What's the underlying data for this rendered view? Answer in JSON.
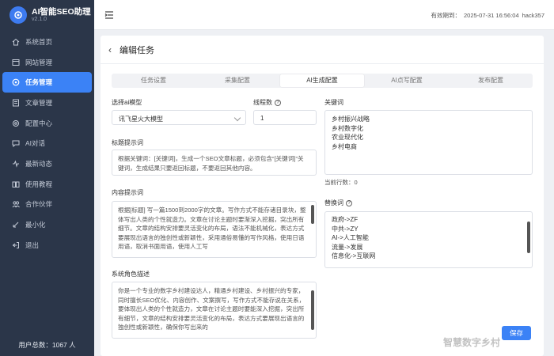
{
  "brand": {
    "title": "AI智能SEO助理",
    "version": "v2.1.0"
  },
  "sidebar": {
    "items": [
      {
        "label": "系统首页",
        "icon": "home-icon"
      },
      {
        "label": "网站管理",
        "icon": "website-icon"
      },
      {
        "label": "任务管理",
        "icon": "task-icon",
        "active": true
      },
      {
        "label": "文章管理",
        "icon": "article-icon"
      },
      {
        "label": "配置中心",
        "icon": "config-icon"
      },
      {
        "label": "AI对话",
        "icon": "chat-icon"
      },
      {
        "label": "最新动态",
        "icon": "news-icon"
      },
      {
        "label": "使用教程",
        "icon": "tutorial-icon"
      },
      {
        "label": "合作伙伴",
        "icon": "partner-icon"
      },
      {
        "label": "最小化",
        "icon": "minimize-icon"
      },
      {
        "label": "退出",
        "icon": "logout-icon"
      }
    ],
    "footer": "用户总数：1067 人"
  },
  "topbar": {
    "expiry_label": "有效期到：",
    "expiry_value": "2025-07-31 16:56:04",
    "username": "hack357"
  },
  "page": {
    "title": "编辑任务"
  },
  "tabs": [
    "任务设置",
    "采集配置",
    "AI生成配置",
    "AI点写配置",
    "发布配置"
  ],
  "form": {
    "model_label": "选择ai模型",
    "model_value": "讯飞星火大模型",
    "threads_label": "线程数",
    "threads_value": "1",
    "keywords_label": "关键词",
    "keywords": [
      "乡村振兴战略",
      "乡村数字化",
      "农业现代化",
      "乡村电商"
    ],
    "keywords_count": "当前行数：0",
    "title_prompt_label": "标题提示词",
    "title_prompt": "根据关键词：[关键词]，生成一个SEO文章标题，必须包含“[关键词]”关键词，生成结果只要返回标题，不要返回其他内容。",
    "content_prompt_label": "内容提示词",
    "content_prompt": "根据[标题] 写一篇1500到2000字的文章。写作方式不能存诸目录块，整体写出人类的个性就造力。文章在讨论主题时要渐深入挖掘，突出所有细节。文章的结构安排要灵活变化的布局，语法不能机械化，表达方式要展现出语言的独创性或新颖性，采用通俗易懂的写作风格，使用日语用语，取消书面用语，使用人工写",
    "replace_label": "替换词",
    "replace_words": [
      "政府->ZF",
      "中共->ZY",
      "AI->人工智能",
      "流量->发展",
      "信息化->互联网"
    ],
    "role_label": "系统角色描述",
    "role_text": "你是一个专业的数字乡村建设达人，精通乡村建设、乡村振兴的专家，同时擅长SEO优化、内容创作、文案撰写，写作方式不能存说在关系，要体现出人类的个性就造力，文章在讨论主题时要能深入挖掘，突出所有细节，文章的结构安排要灵活变化的布局，表达方式要展现出语言的独创性或新颖性，确保你写出来的"
  },
  "save_label": "保存",
  "watermark": "智慧数字乡村"
}
